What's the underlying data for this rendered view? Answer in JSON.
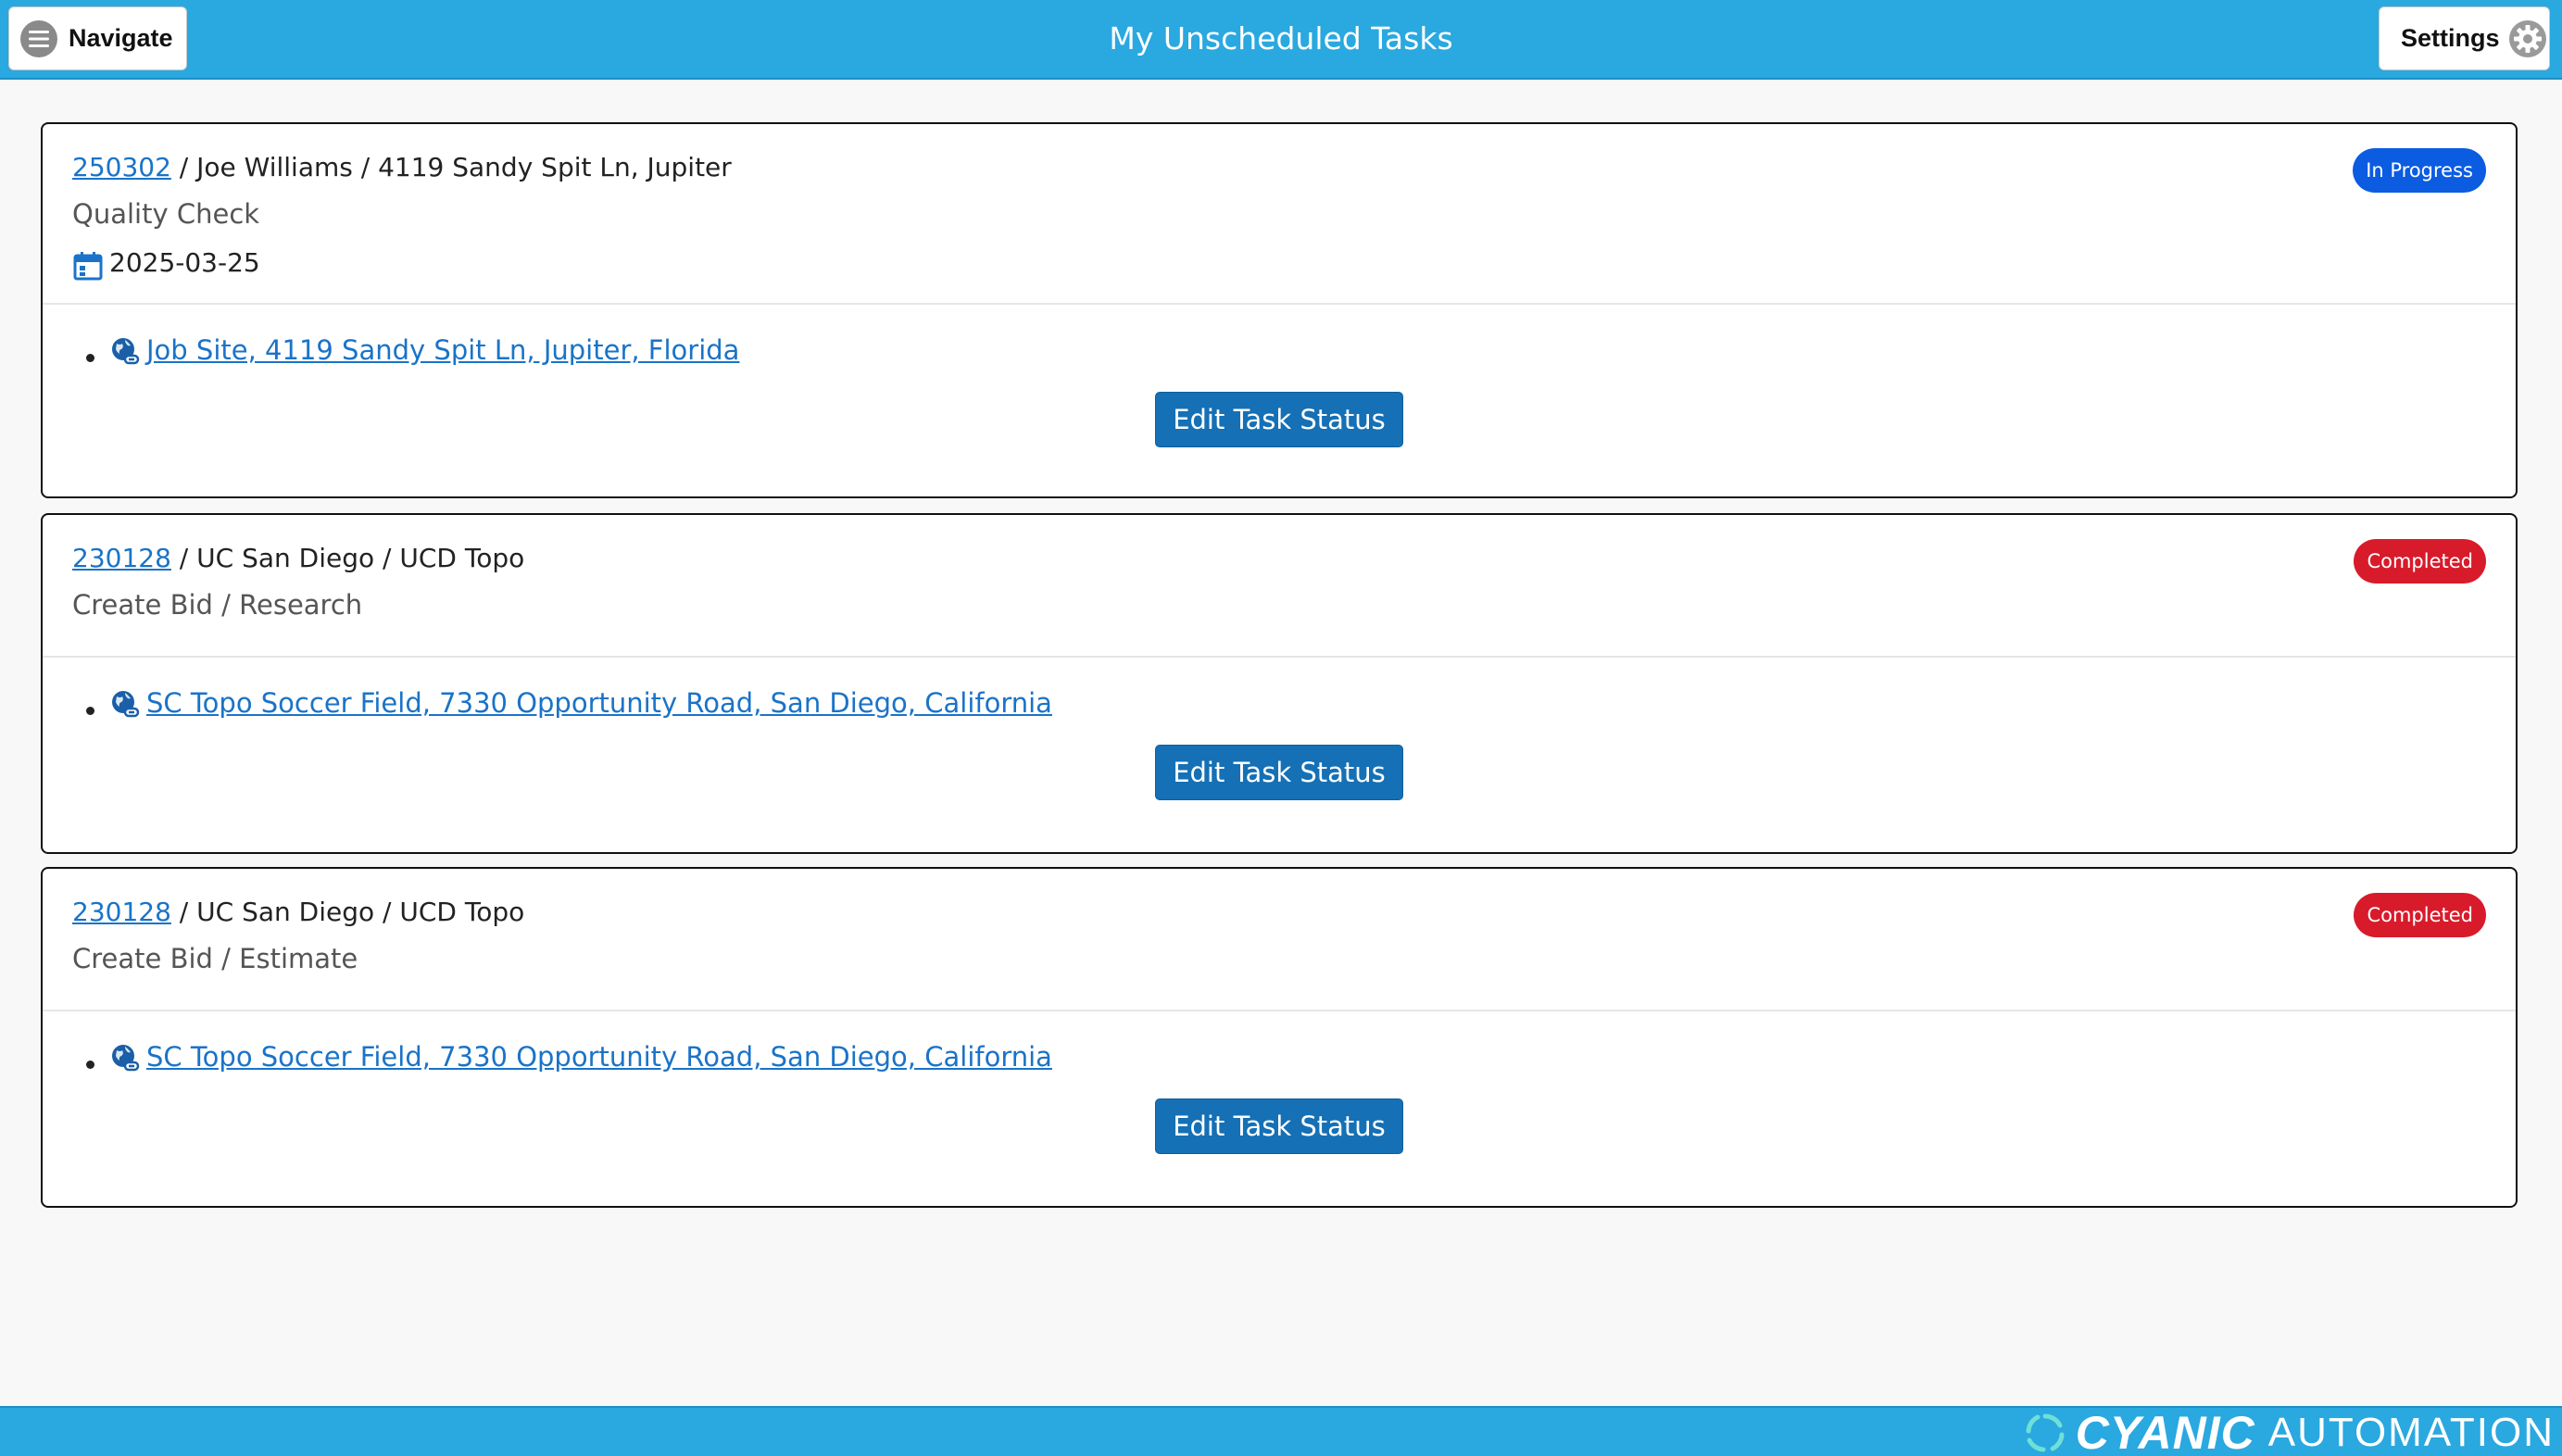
{
  "header": {
    "title": "My Unscheduled Tasks",
    "navigate_label": "Navigate",
    "settings_label": "Settings"
  },
  "tasks": [
    {
      "job_number": "250302",
      "job_info": " / Joe Williams / 4119 Sandy Spit Ln, Jupiter",
      "task_name": "Quality Check",
      "date": "2025-03-25",
      "status": "In Progress",
      "status_color": "#0b5ce0",
      "location": " Job Site, 4119 Sandy Spit Ln, Jupiter, Florida",
      "edit_label": "Edit Task Status"
    },
    {
      "job_number": "230128",
      "job_info": " / UC San Diego / UCD Topo",
      "task_name": "Create Bid / Research",
      "status": "Completed",
      "status_color": "#d81b2b",
      "location": " SC Topo Soccer Field, 7330 Opportunity Road, San Diego, California",
      "edit_label": "Edit Task Status"
    },
    {
      "job_number": "230128",
      "job_info": " / UC San Diego / UCD Topo",
      "task_name": "Create Bid / Estimate",
      "status": "Completed",
      "status_color": "#d81b2b",
      "location": " SC Topo Soccer Field, 7330 Opportunity Road, San Diego, California",
      "edit_label": "Edit Task Status"
    }
  ],
  "footer": {
    "logo_word1": "CYANIC",
    "logo_word2": "AUTOMATION"
  },
  "colors": {
    "header_bg": "#2aa8e0",
    "link": "#1a73c8",
    "button": "#1570b5"
  },
  "icons": [
    "hamburger-menu-icon",
    "gear-icon",
    "calendar-icon",
    "globe-link-icon",
    "cyanic-logo-icon"
  ]
}
